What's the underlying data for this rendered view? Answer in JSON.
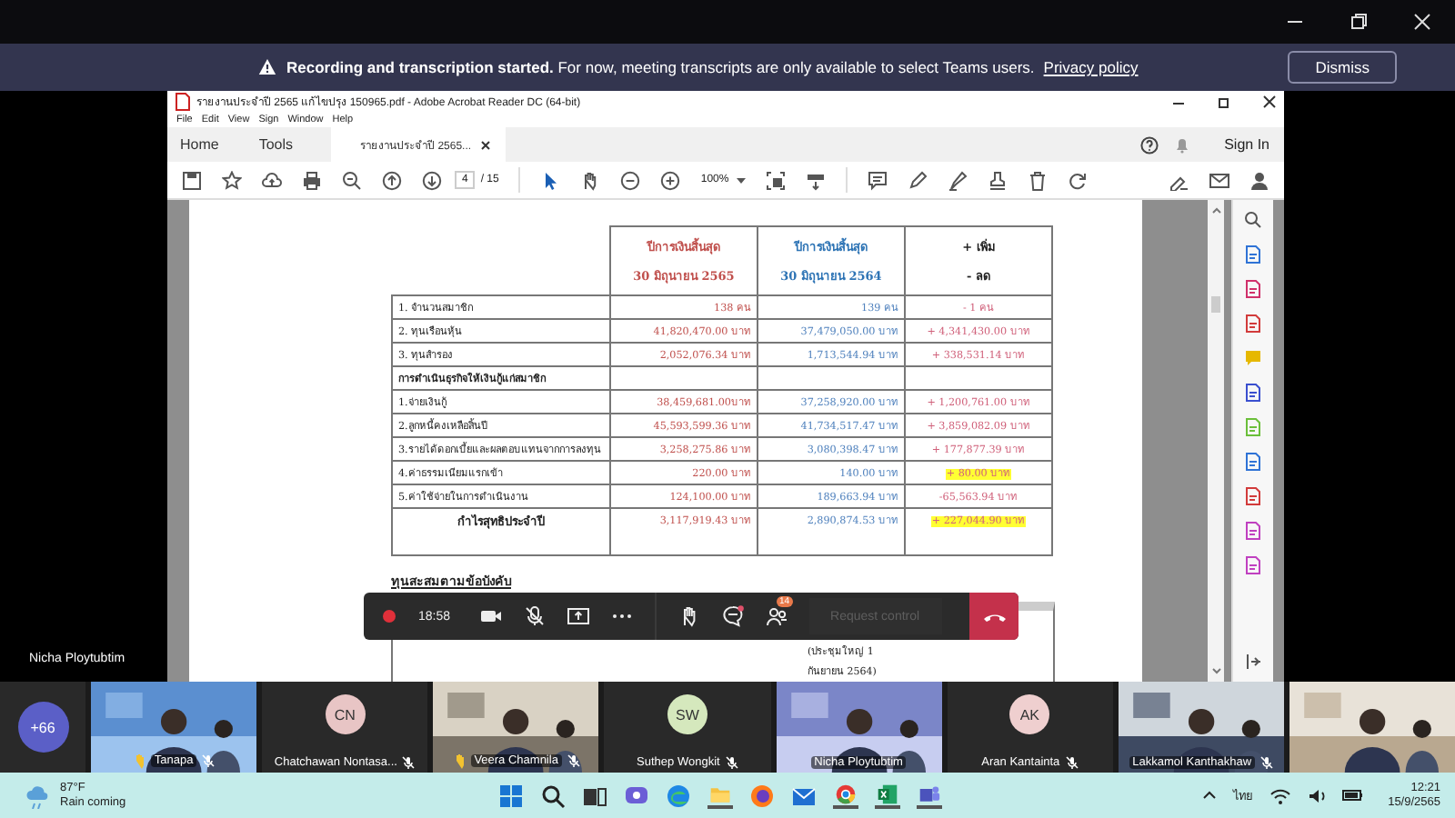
{
  "banner": {
    "message": "**Recording and transcription started.** For now, meeting transcripts are only available to select Teams users.",
    "link": "Privacy policy",
    "button": "Dismiss"
  },
  "acrobat": {
    "title": "รายงานประจำปี 2565 แก้ไขปรุง 150965.pdf - Adobe Acrobat Reader DC (64-bit)",
    "menu": [
      "File",
      "Edit",
      "View",
      "Sign",
      "Window",
      "Help"
    ],
    "tabs": [
      {
        "label": "Home",
        "selected": false
      },
      {
        "label": "Tools",
        "selected": false
      },
      {
        "label": "รายงานประจำปี 2565...",
        "selected": true
      }
    ],
    "sign_in": "Sign In",
    "page": "4",
    "page_total": "/ 15",
    "zoom": "100%"
  },
  "document": {
    "headers": [
      {
        "title": "ปีการเงินสิ้นสุด",
        "subtitle": "30 มิถุนายน 2565"
      },
      {
        "title": "ปีการเงินสิ้นสุด",
        "subtitle": "30 มิถุนายน 2564"
      },
      {
        "title": "+  เพิ่ม",
        "subtitle": "-   ลด"
      }
    ],
    "rows": [
      {
        "kind": "row",
        "cells": [
          "1. จำนวนสมาชิก",
          "138 คน",
          "139 คน",
          "-   1 คน"
        ],
        "highlight": false
      },
      {
        "kind": "row",
        "cells": [
          "2. ทุนเรือนหุ้น",
          "41,820,470.00 บาท",
          "37,479,050.00 บาท",
          "+ 4,341,430.00 บาท"
        ],
        "highlight": false
      },
      {
        "kind": "row",
        "cells": [
          "3. ทุนสำรอง",
          "2,052,076.34 บาท",
          "1,713,544.94 บาท",
          "+ 338,531.14 บาท"
        ],
        "highlight": false
      },
      {
        "kind": "section",
        "cells": [
          "การดำเนินธุรกิจให้เงินกู้แก่สมาชิก"
        ],
        "highlight": false
      },
      {
        "kind": "row",
        "cells": [
          "1.จ่ายเงินกู้",
          "38,459,681.00บาท",
          "37,258,920.00 บาท",
          "+ 1,200,761.00 บาท"
        ],
        "highlight": false
      },
      {
        "kind": "row",
        "cells": [
          "2.ลูกหนี้คงเหลือสิ้นปี",
          "45,593,599.36 บาท",
          "41,734,517.47 บาท",
          "+ 3,859,082.09 บาท"
        ],
        "highlight": false
      },
      {
        "kind": "row",
        "cells": [
          "3.รายได้ดอกเบี้ยและผลตอบแทนจากการลงทุน",
          "3,258,275.86 บาท",
          "3,080,398.47 บาท",
          "+ 177,877.39 บาท"
        ],
        "highlight": false
      },
      {
        "kind": "row",
        "cells": [
          "4.ค่าธรรมเนียมแรกเข้า",
          "220.00 บาท",
          "140.00 บาท",
          "+ 80.00 บาท"
        ],
        "highlight": true
      },
      {
        "kind": "row",
        "cells": [
          "5.ค่าใช้จ่ายในการดำเนินงาน",
          "124,100.00 บาท",
          "189,663.94 บาท",
          "-65,563.94 บาท"
        ],
        "highlight": false
      },
      {
        "kind": "total",
        "cells": [
          "กำไรสุทธิประจำปี",
          "3,117,919.43 บาท",
          "2,890,874.53 บาท",
          "+ 227,044.90 บาท"
        ],
        "highlight": true
      }
    ],
    "heading": "ทุนสะสมตามข้อบังคับ",
    "lower_lines": [
      "(ประชุมใหญ่ 1",
      "กันยายน 2564)"
    ]
  },
  "presenter": "Nicha Ploytubtim",
  "call_bar": {
    "timer": "18:58",
    "recording": true,
    "chat_unread": true,
    "participants_badge": "14",
    "request_control": {
      "label": "Request control",
      "disabled": true
    }
  },
  "participants": {
    "overflow": "+66",
    "tiles": [
      {
        "kind": "video",
        "name": "Tanapa",
        "hand_raised": true,
        "muted": true
      },
      {
        "kind": "avatar",
        "initials": "CN",
        "color": "#e8c5c5",
        "name": "Chatchawan Nontasa...",
        "hand_raised": false,
        "muted": true
      },
      {
        "kind": "video",
        "name": "Veera Chamnila",
        "hand_raised": true,
        "muted": true
      },
      {
        "kind": "avatar",
        "initials": "SW",
        "color": "#d5e8bd",
        "name": "Suthep Wongkit",
        "hand_raised": false,
        "muted": true
      },
      {
        "kind": "video",
        "name": "Nicha Ploytubtim",
        "hand_raised": false,
        "muted": false
      },
      {
        "kind": "avatar",
        "initials": "AK",
        "color": "#efcfcf",
        "name": "Aran Kantainta",
        "hand_raised": false,
        "muted": true
      },
      {
        "kind": "video",
        "name": "Lakkamol Kanthakhaw",
        "hand_raised": false,
        "muted": true
      },
      {
        "kind": "video",
        "hand_raised": false,
        "muted": false
      }
    ]
  },
  "taskbar": {
    "temperature": "87°F",
    "weather": "Rain coming",
    "language": "ไทย",
    "time": "12:21",
    "date": "15/9/2565"
  }
}
